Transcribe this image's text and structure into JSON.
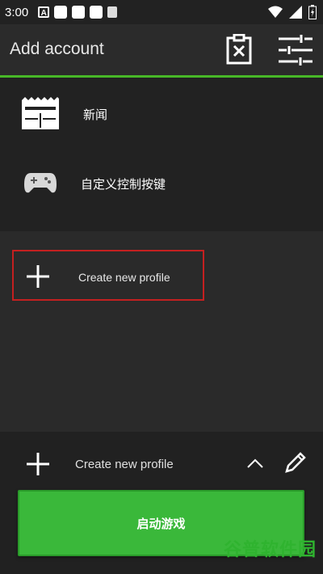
{
  "status_bar": {
    "time": "3:00",
    "notif_letter": "A"
  },
  "app_bar": {
    "title": "Add account"
  },
  "menu": {
    "items": [
      {
        "label": "新闻",
        "icon": "news-icon"
      },
      {
        "label": "自定义控制按键",
        "icon": "gamepad-icon"
      }
    ]
  },
  "profiles": {
    "create_label": "Create new profile"
  },
  "bottom_bar": {
    "create_label": "Create new profile",
    "play_label": "启动游戏"
  },
  "watermark": {
    "text": "谷普软件园"
  },
  "colors": {
    "accent": "#48b828",
    "play_button": "#3ab83a",
    "highlight_border": "#c42020"
  }
}
